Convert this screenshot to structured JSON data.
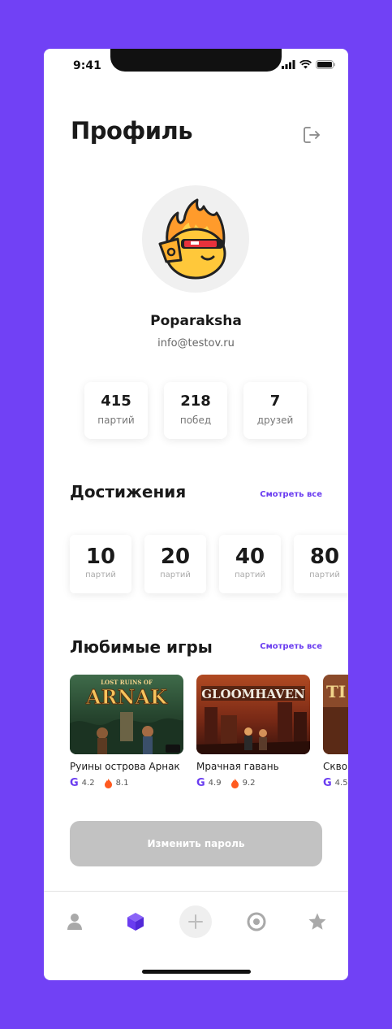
{
  "status": {
    "time": "9:41"
  },
  "header": {
    "title": "Профиль"
  },
  "user": {
    "name": "Poparaksha",
    "email": "info@testov.ru"
  },
  "stats": [
    {
      "value": "415",
      "label": "партий"
    },
    {
      "value": "218",
      "label": "побед"
    },
    {
      "value": "7",
      "label": "друзей"
    }
  ],
  "achievements": {
    "title": "Достижения",
    "see_all": "Смотреть все",
    "items": [
      {
        "value": "10",
        "label": "партий"
      },
      {
        "value": "20",
        "label": "партий"
      },
      {
        "value": "40",
        "label": "партий"
      },
      {
        "value": "80",
        "label": "партий"
      }
    ]
  },
  "favorites": {
    "title": "Любимые игры",
    "see_all": "Смотреть все",
    "items": [
      {
        "name": "Руины острова Арнак",
        "cover_text": "ARNAK",
        "cover_subtext": "LOST RUINS OF",
        "g_rating": "4.2",
        "flame_rating": "8.1"
      },
      {
        "name": "Мрачная гавань",
        "cover_text": "GLOOMHAVEN",
        "g_rating": "4.9",
        "flame_rating": "9.2"
      },
      {
        "name": "Скво",
        "cover_text": "TI",
        "g_rating": "4.5"
      }
    ]
  },
  "change_password_button": "Изменить пароль",
  "g_letter": "G",
  "colors": {
    "accent": "#6a3cf0",
    "background": "#7141f5",
    "button_disabled": "#c2c2c2"
  },
  "tabs": [
    "profile-icon",
    "cube-icon",
    "plus-icon",
    "target-icon",
    "star-icon"
  ]
}
